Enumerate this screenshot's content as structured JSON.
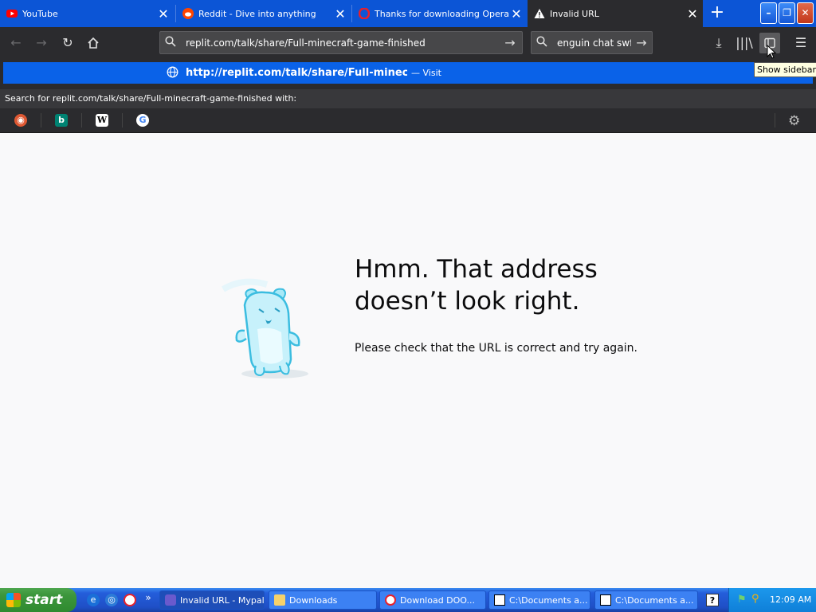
{
  "tabs": [
    {
      "title": "YouTube",
      "favicon": "youtube-icon",
      "active": false
    },
    {
      "title": "Reddit - Dive into anything",
      "favicon": "reddit-icon",
      "active": false
    },
    {
      "title": "Thanks for downloading Opera",
      "favicon": "opera-icon",
      "active": false
    },
    {
      "title": "Invalid URL",
      "favicon": "warning-icon",
      "active": true
    }
  ],
  "window_controls": {
    "minimize": "minimize-icon",
    "restore": "restore-icon",
    "close": "close-icon"
  },
  "navbar": {
    "url": "replit.com/talk/share/Full-minecraft-game-finished",
    "search_value": "enguin chat swf"
  },
  "suggestion": {
    "url_prefix": "http://",
    "url_bold": "replit.com/talk/share/Full-minecraft",
    "visit_label": "— Visit"
  },
  "search_with": {
    "label": "Search for replit.com/talk/share/Full-minecraft-game-finished with:",
    "engines": [
      "duckduckgo-icon",
      "bing-icon",
      "wikipedia-icon",
      "google-icon"
    ]
  },
  "tooltip": "Show sidebars",
  "error": {
    "heading": "Hmm. That address doesn’t look right.",
    "subtext": "Please check that the URL is correct and try again."
  },
  "taskbar": {
    "start_label": "start",
    "tasks": [
      {
        "label": "Invalid URL - Mypal",
        "icon": "mypal-icon",
        "active": true
      },
      {
        "label": "Downloads",
        "icon": "folder-icon",
        "active": false
      },
      {
        "label": "Download DOO...",
        "icon": "opera-icon",
        "active": false
      },
      {
        "label": "C:\\Documents a...",
        "icon": "7zip-icon",
        "active": false
      },
      {
        "label": "C:\\Documents a...",
        "icon": "7zip-icon",
        "active": false
      }
    ],
    "time": "12:09 AM"
  },
  "colors": {
    "tab_strip": "#0c55d6",
    "toolbar": "#2b2b2e",
    "suggestion_highlight": "#0a62e8",
    "page_bg": "#f9f9fa"
  }
}
